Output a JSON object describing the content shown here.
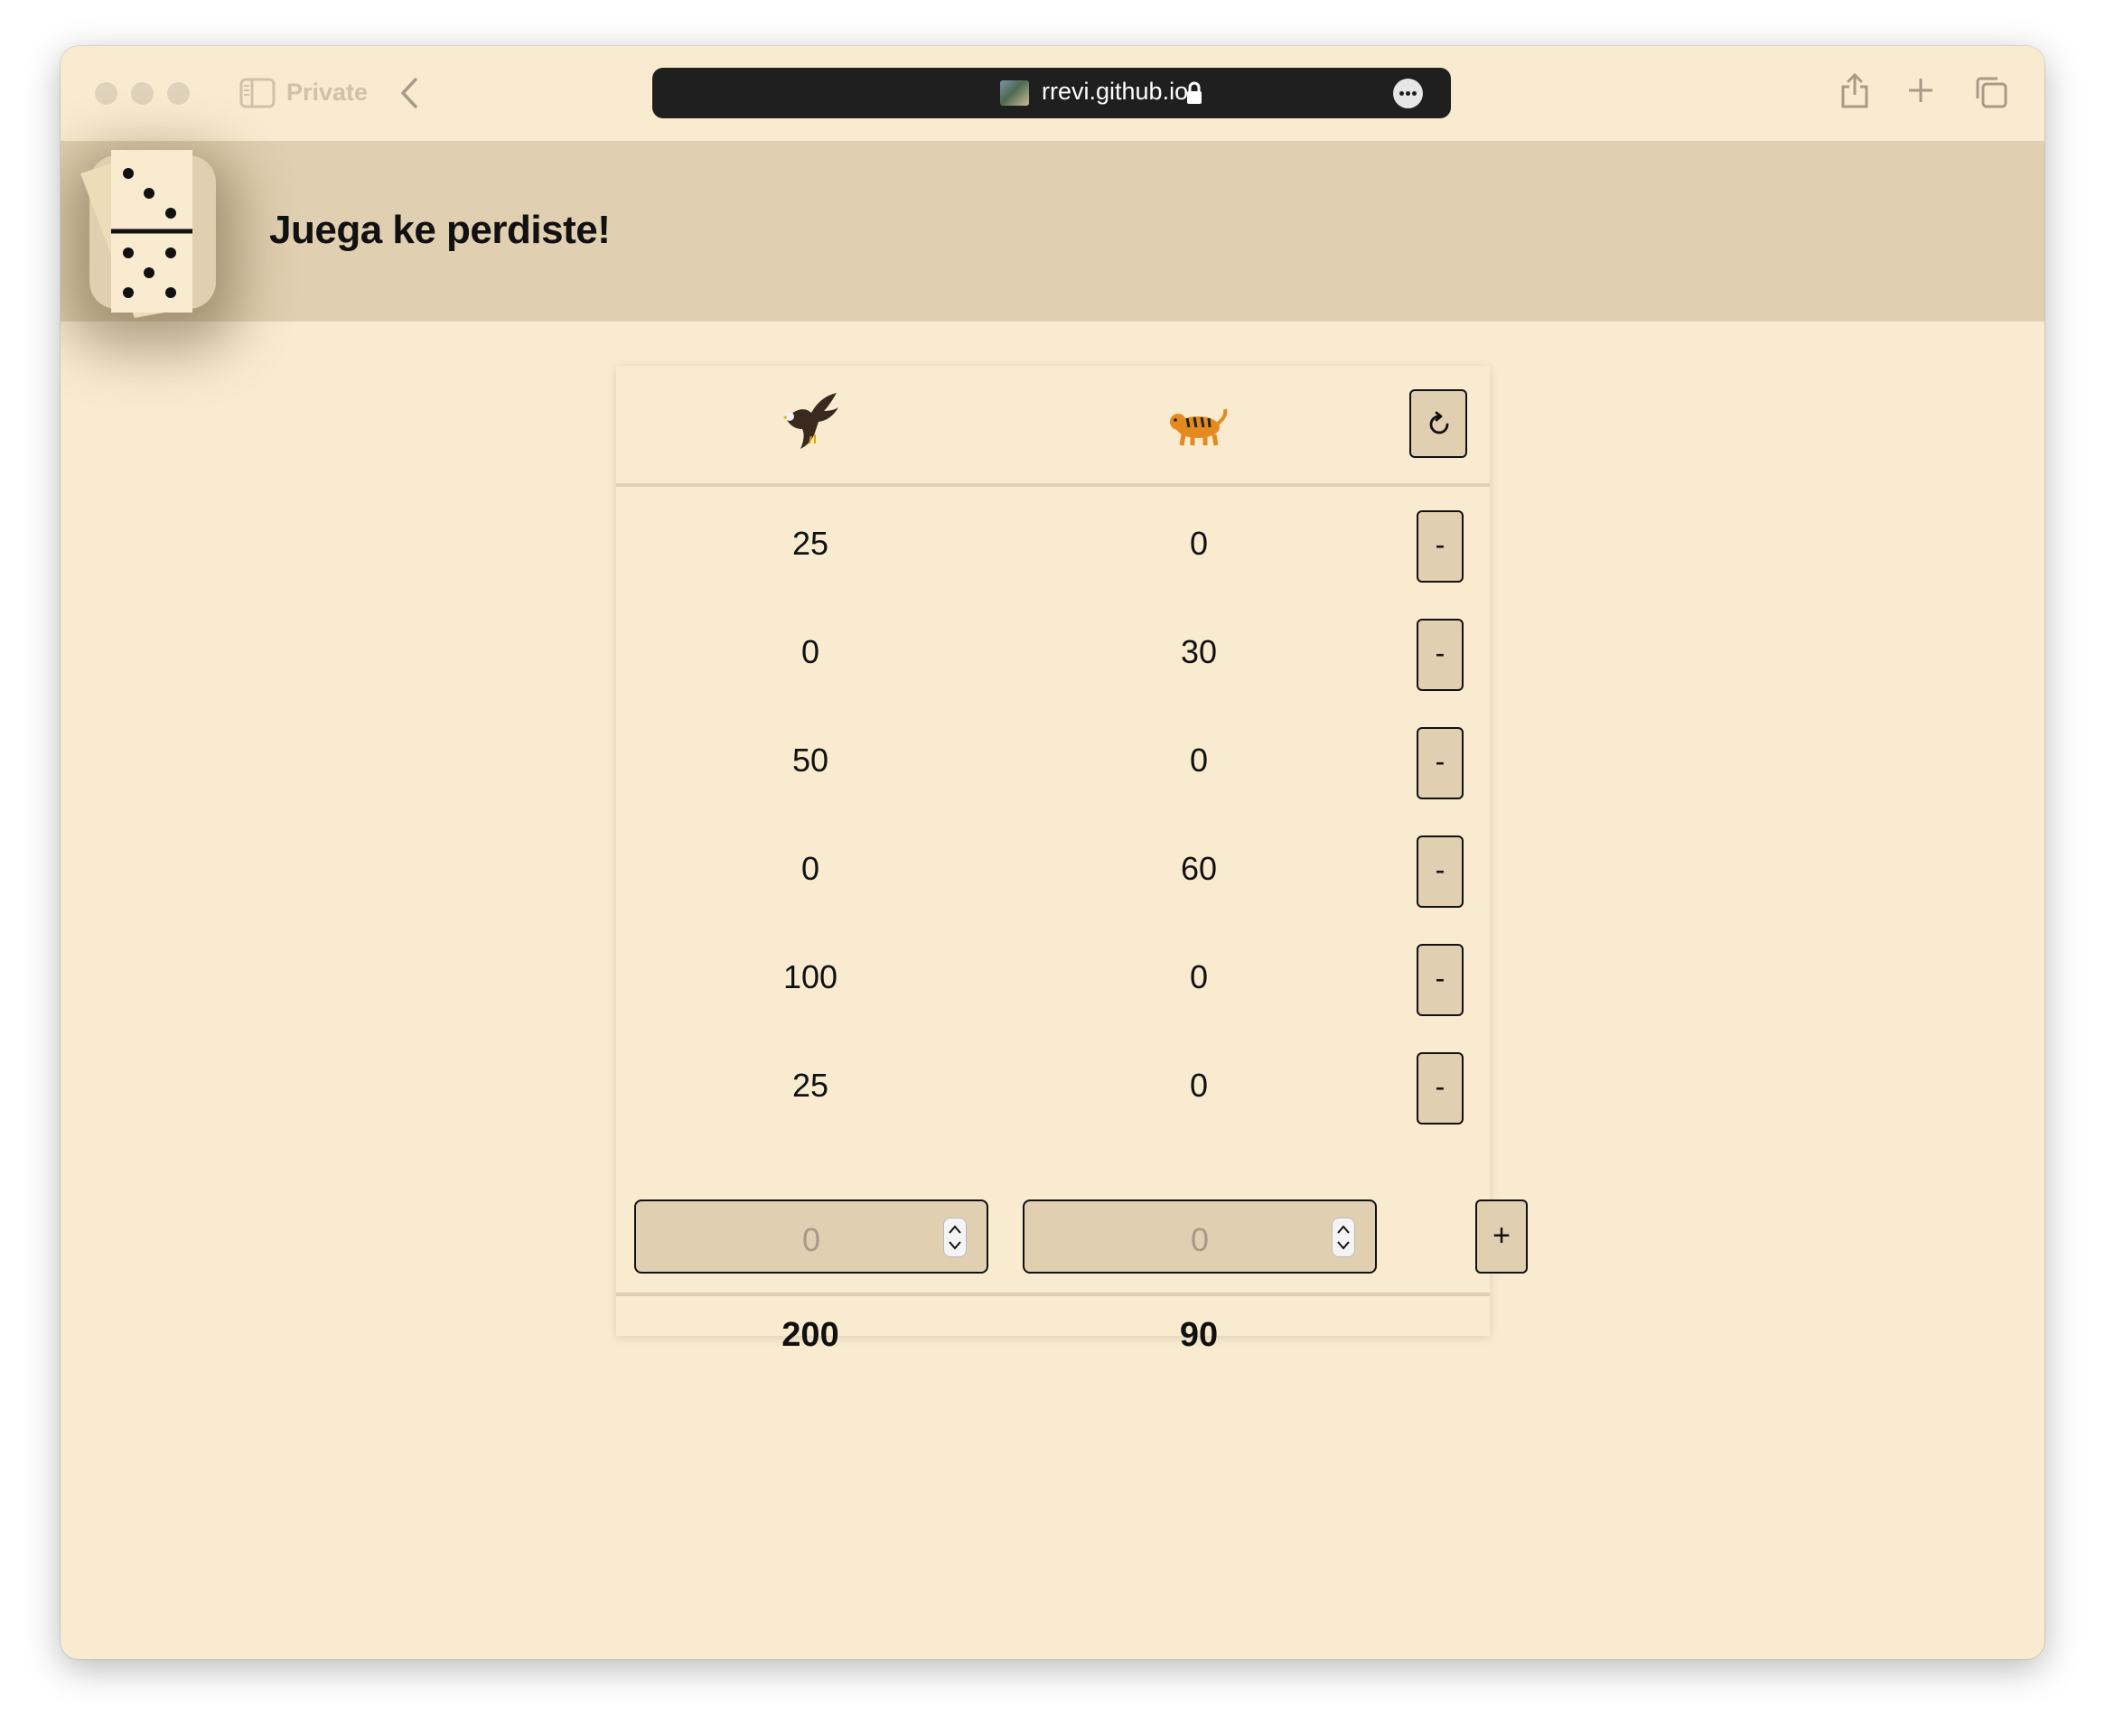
{
  "browser": {
    "private_label": "Private",
    "url": "rrevi.github.io"
  },
  "app": {
    "title": "Juega ke perdiste!"
  },
  "teams": [
    {
      "icon": "eagle-icon",
      "emoji": "🦅"
    },
    {
      "icon": "tiger-icon",
      "emoji": "🐅"
    }
  ],
  "rows": [
    {
      "a": "25",
      "b": "0",
      "remove_label": "-"
    },
    {
      "a": "0",
      "b": "30",
      "remove_label": "-"
    },
    {
      "a": "50",
      "b": "0",
      "remove_label": "-"
    },
    {
      "a": "0",
      "b": "60",
      "remove_label": "-"
    },
    {
      "a": "100",
      "b": "0",
      "remove_label": "-"
    },
    {
      "a": "25",
      "b": "0",
      "remove_label": "-"
    }
  ],
  "inputs": {
    "a_placeholder": "0",
    "b_placeholder": "0",
    "add_label": "+"
  },
  "totals": {
    "a": "200",
    "b": "90"
  },
  "colors": {
    "background": "#f9ebd0",
    "header": "#e0cfb0",
    "url_bar": "#1f1f1f"
  }
}
